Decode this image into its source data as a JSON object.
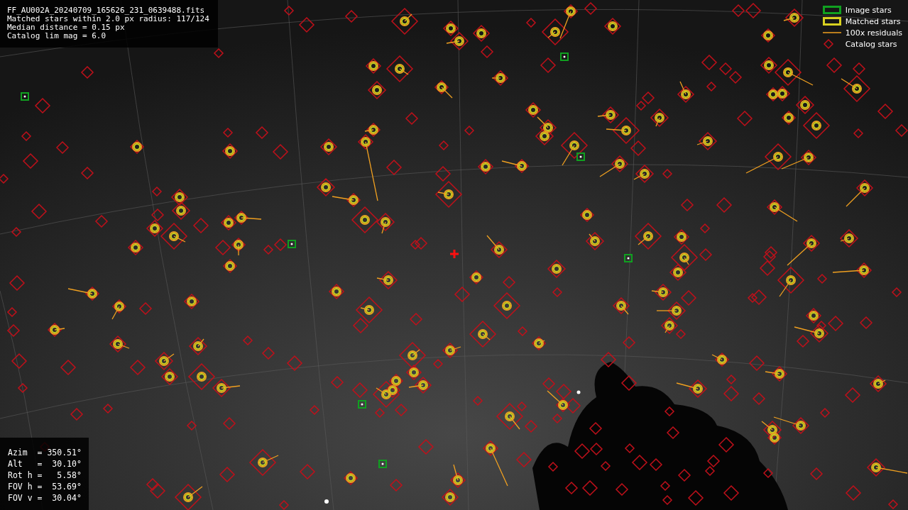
{
  "info_panel": {
    "lines": [
      "FF_AU002A_20240709_165626_231_0639488.fits",
      "Matched stars within 2.0 px radius: 117/124",
      "Median distance = 0.15 px",
      "Catalog lim mag = 6.0"
    ]
  },
  "legend": {
    "items": [
      {
        "label": "Image stars",
        "kind": "image"
      },
      {
        "label": "Matched stars",
        "kind": "matched"
      },
      {
        "label": "100x residuals",
        "kind": "residual"
      },
      {
        "label": "Catalog stars",
        "kind": "catalog"
      }
    ]
  },
  "pointing_panel": {
    "lines": [
      "Azim  = 350.51°",
      "Alt   =  30.10°",
      "Rot h =   5.58°",
      "FOV h =  53.69°",
      "FOV v =  30.04°"
    ]
  }
}
